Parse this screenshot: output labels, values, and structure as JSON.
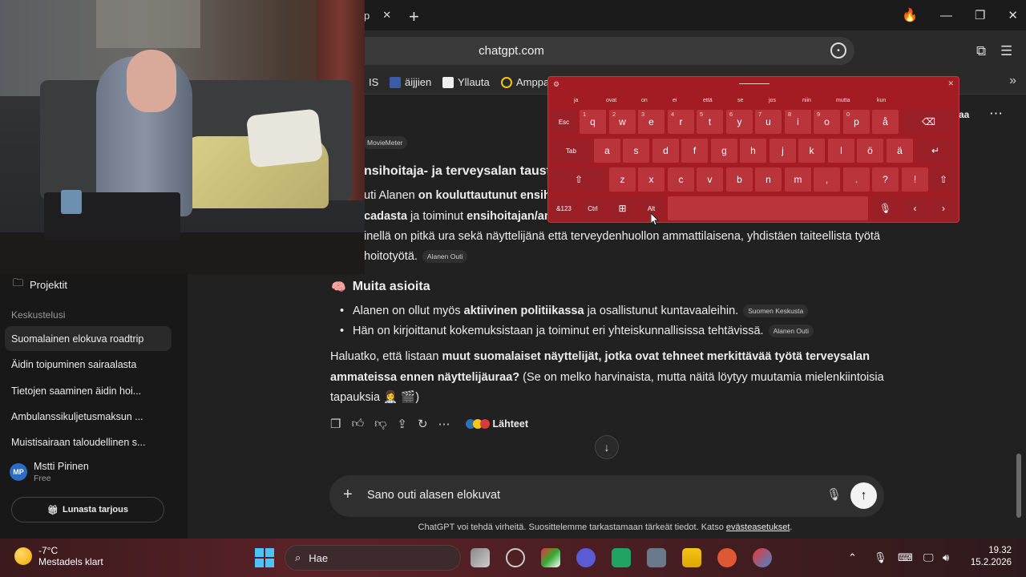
{
  "browser": {
    "tab_close": "✕",
    "new_tab": "+",
    "address": "chatgpt.com",
    "bookmarks": [
      {
        "label": "IS"
      },
      {
        "label": "äijjien"
      },
      {
        "label": "Yllauta"
      },
      {
        "label": "Amppa"
      }
    ],
    "more": "»"
  },
  "sidebar": {
    "projects": "Projektit",
    "section_label": "Keskustelusi",
    "items": [
      {
        "label": "Suomalainen elokuva roadtrip"
      },
      {
        "label": "Äidin toipuminen sairaalasta"
      },
      {
        "label": "Tietojen saaminen äidin hoi..."
      },
      {
        "label": "Ambulanssikuljetusmaksun ..."
      },
      {
        "label": "Muistisairaan taloudellinen s..."
      }
    ],
    "user": {
      "initials": "MP",
      "name": "Mstti Pirinen",
      "plan": "Free"
    },
    "offer_button": "Lunasta tarjous"
  },
  "header": {
    "share_fragment": "aa",
    "menu": "⋯"
  },
  "content": {
    "moviemeter_chip": "MovieMeter",
    "heading1": "nsihoitaja- ja terveysalan tausta",
    "p1_line1_a": "uti Alanen ",
    "p1_line1_b": "on kouluttautunut ensiho",
    "p1_line2_a": "cadasta",
    "p1_line2_b": " ja toiminut ",
    "p1_line2_c": "ensihoitajan/am",
    "p2_line1": "inellä on pitkä ura sekä näyttelijänä että terveydenhuollon ammattilaisena, yhdistäen taiteellista työtä",
    "p2_line2": "hoitotyötä.",
    "chip_alanen_outi": "Alanen Outi",
    "heading2": "Muita asioita",
    "bullet1_a": "Alanen on ollut myös ",
    "bullet1_b": "aktiivinen politiikassa",
    "bullet1_c": " ja osallistunut kuntavaaleihin.",
    "chip_keskusta": "Suomen Keskusta",
    "bullet2": "Hän on kirjoittanut kokemuksistaan ja toiminut eri yhteiskunnallisissa tehtävissä.",
    "chip_alanen_outi2": "Alanen Outi",
    "q_line1_a": "Haluatko, että listaan ",
    "q_line1_b": "muut suomalaiset näyttelijät, jotka ovat tehneet merkittävää työtä terveysalan",
    "q_line2_a": "ammateissa ennen näyttelijäuraa?",
    "q_line2_b": " (Se on melko harvinaista, mutta näitä löytyy muutamia mielenkiintoisia",
    "q_line3": "tapauksia 👩‍⚕️ 🎬)",
    "sources_label": "Lähteet"
  },
  "composer": {
    "plus": "+",
    "text": "Sano outi alasen elokuvat",
    "send": "↑"
  },
  "disclaimer": {
    "text": "ChatGPT voi tehdä virheitä. Suosittelemme tarkastamaan tärkeät tiedot. Katso ",
    "link": "evästeasetukset",
    "end": "."
  },
  "keyboard": {
    "suggestions": [
      "ja",
      "ovat",
      "on",
      "ei",
      "että",
      "se",
      "jos",
      "niin",
      "mutta",
      "kun"
    ],
    "row1": [
      {
        "k": "Esc",
        "s": ""
      },
      {
        "k": "q",
        "s": "1"
      },
      {
        "k": "w",
        "s": "2"
      },
      {
        "k": "e",
        "s": "3"
      },
      {
        "k": "r",
        "s": "4"
      },
      {
        "k": "t",
        "s": "5"
      },
      {
        "k": "y",
        "s": "6"
      },
      {
        "k": "u",
        "s": "7"
      },
      {
        "k": "i",
        "s": "8"
      },
      {
        "k": "o",
        "s": "9"
      },
      {
        "k": "p",
        "s": "0"
      },
      {
        "k": "å",
        "s": ""
      },
      {
        "k": "⌫",
        "s": ""
      }
    ],
    "row2": [
      {
        "k": "Tab"
      },
      {
        "k": "a"
      },
      {
        "k": "s"
      },
      {
        "k": "d"
      },
      {
        "k": "f"
      },
      {
        "k": "g"
      },
      {
        "k": "h"
      },
      {
        "k": "j"
      },
      {
        "k": "k"
      },
      {
        "k": "l"
      },
      {
        "k": "ö"
      },
      {
        "k": "ä"
      },
      {
        "k": "↵"
      }
    ],
    "row3": [
      {
        "k": "⇧"
      },
      {
        "k": "z"
      },
      {
        "k": "x"
      },
      {
        "k": "c"
      },
      {
        "k": "v"
      },
      {
        "k": "b"
      },
      {
        "k": "n"
      },
      {
        "k": "m"
      },
      {
        "k": ","
      },
      {
        "k": "."
      },
      {
        "k": "?"
      },
      {
        "k": "!"
      },
      {
        "k": "⇧"
      }
    ],
    "row4": [
      {
        "k": "&123"
      },
      {
        "k": "Ctrl"
      },
      {
        "k": "⊞"
      },
      {
        "k": "Alt"
      },
      {
        "k": ""
      },
      {
        "k": "🎙"
      },
      {
        "k": "‹"
      },
      {
        "k": "›"
      }
    ]
  },
  "taskbar": {
    "temp": "-7°C",
    "condition": "Mestadels klart",
    "search": "Hae",
    "time": "19.32",
    "date": "15.2.2026"
  }
}
